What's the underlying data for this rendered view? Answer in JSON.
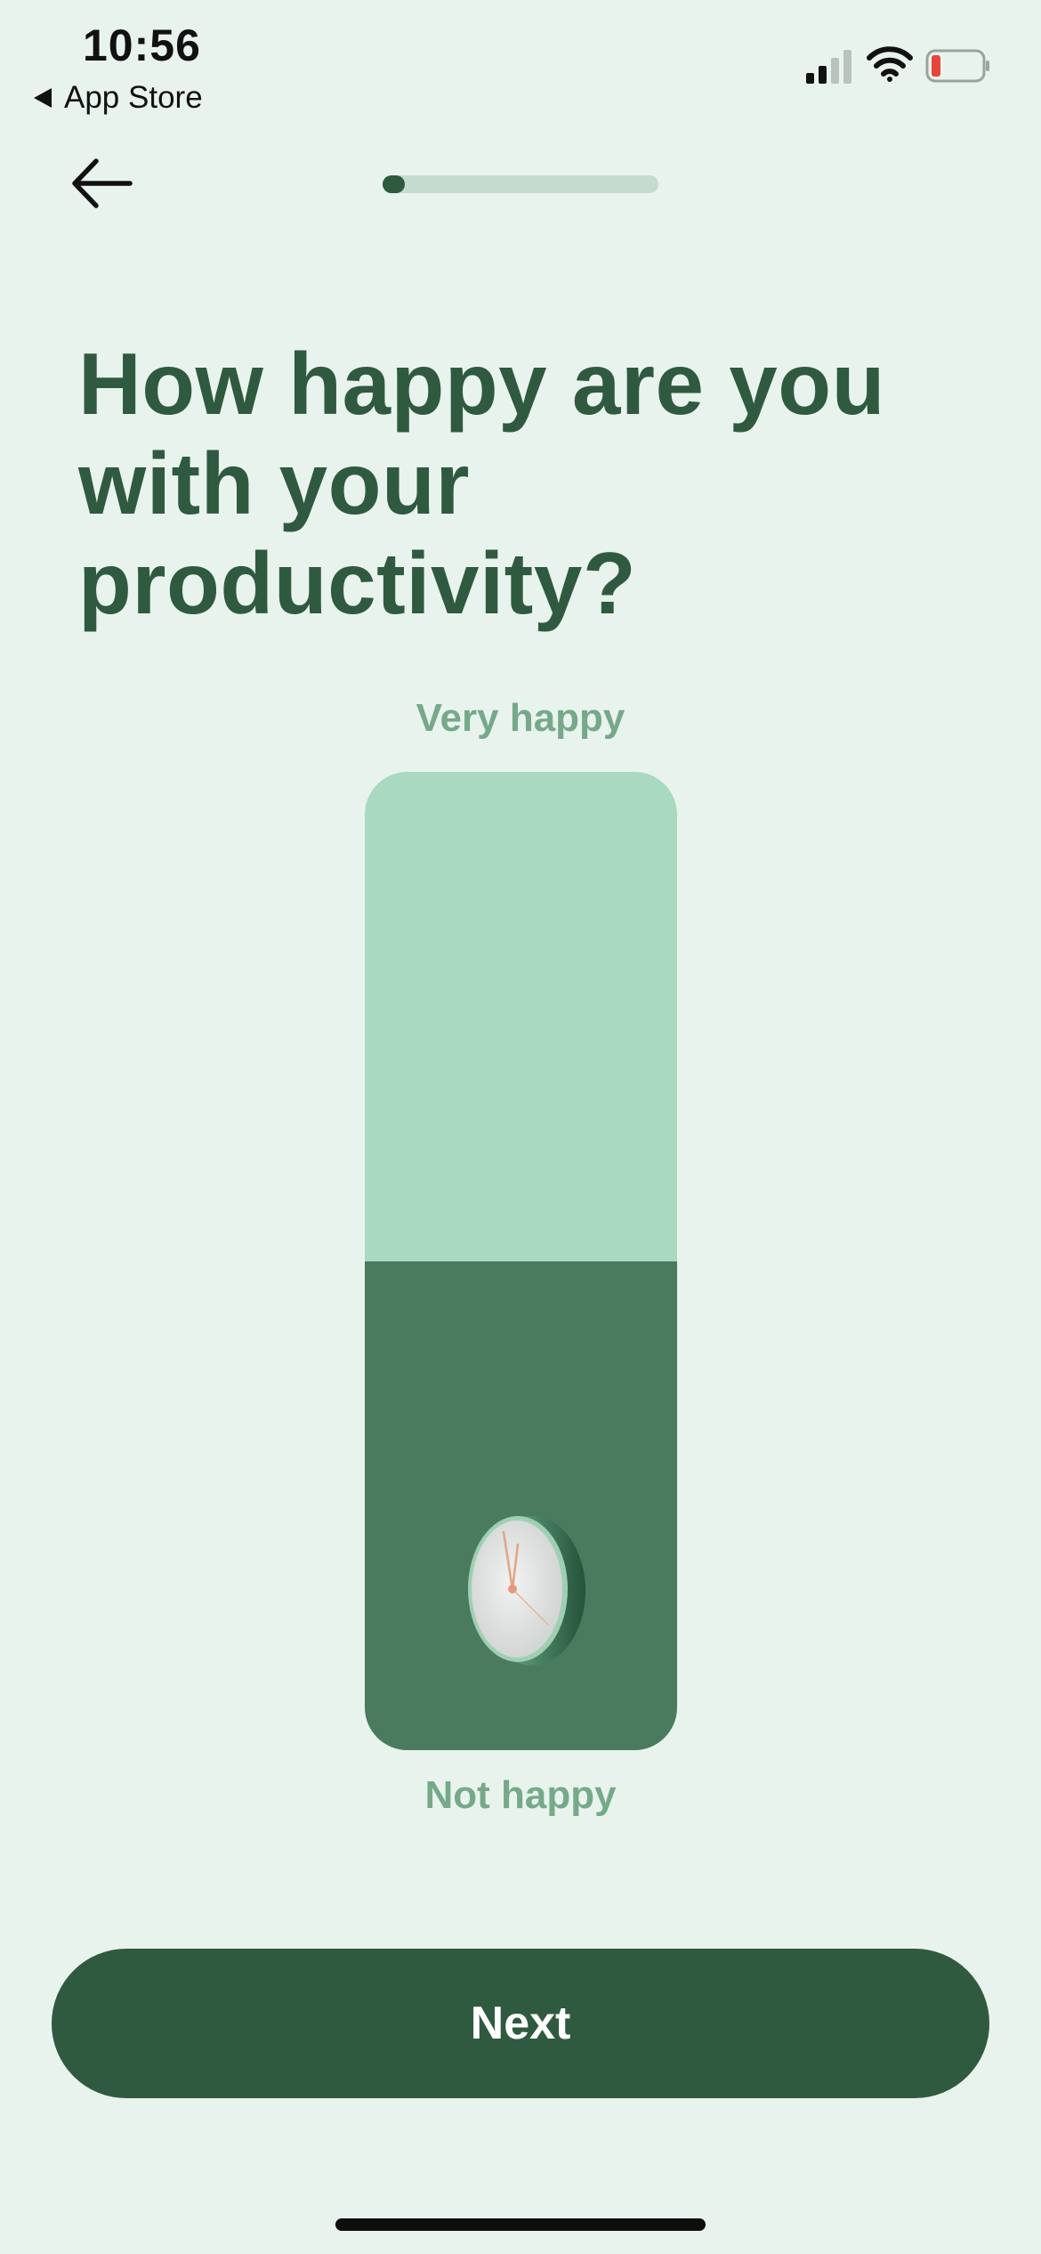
{
  "status_bar": {
    "time": "10:56",
    "back_app_label": "App Store",
    "signal_icon": "cellular-signal-icon",
    "wifi_icon": "wifi-icon",
    "battery_icon": "battery-low-icon",
    "battery_color": "#e5463a"
  },
  "nav": {
    "back_icon": "arrow-left-icon",
    "progress": 0.08
  },
  "question": {
    "title": "How happy are you with your productivity?"
  },
  "scale": {
    "top_label": "Very happy",
    "bottom_label": "Not happy",
    "value": 0.5,
    "handle_icon": "clock-icon",
    "track_color": "#a9d9c0",
    "fill_color": "#4a7b5e"
  },
  "footer": {
    "next_label": "Next"
  },
  "colors": {
    "background": "#e9f3ed",
    "primary": "#2f5a40",
    "label": "#75a98a"
  }
}
